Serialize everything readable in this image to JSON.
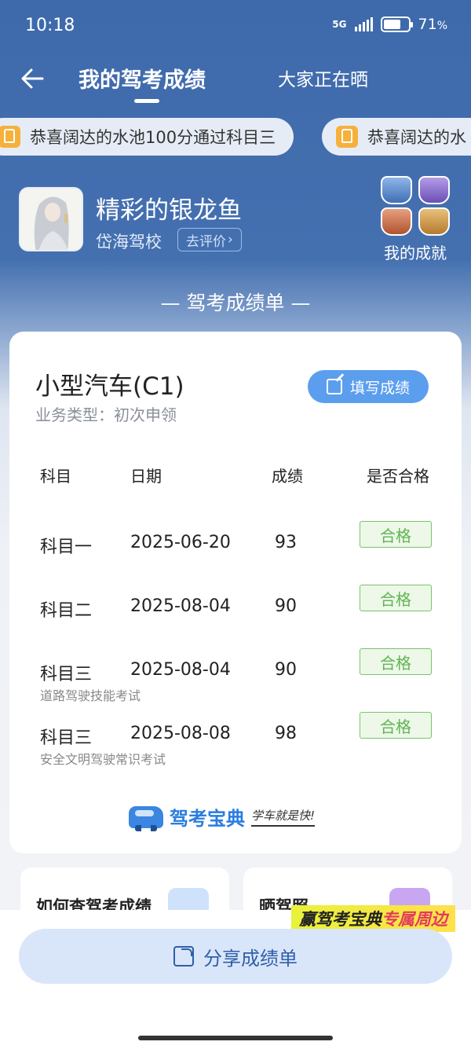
{
  "status": {
    "time": "10:18",
    "network": "5G",
    "battery": "71",
    "battery_level": 0.71
  },
  "nav": {
    "active_tab": "我的驾考成绩",
    "other_tab": "大家正在晒"
  },
  "ticker": [
    {
      "text": "恭喜阔达的水池100分通过科目三"
    },
    {
      "text": "恭喜阔达的水"
    }
  ],
  "profile": {
    "name": "精彩的银龙鱼",
    "school": "岱海驾校",
    "review": "去评价",
    "achievement": "我的成就"
  },
  "section_title": "— 驾考成绩单 —",
  "card": {
    "vehicle": "小型汽车(C1)",
    "business_type": "业务类型：初次申领",
    "fill_button": "填写成绩",
    "headers": {
      "subject": "科目",
      "date": "日期",
      "score": "成绩",
      "pass": "是否合格"
    },
    "rows": [
      {
        "subject": "科目一",
        "date": "2025-06-20",
        "score": "93",
        "status": "合格",
        "note": ""
      },
      {
        "subject": "科目二",
        "date": "2025-08-04",
        "score": "90",
        "status": "合格",
        "note": ""
      },
      {
        "subject": "科目三",
        "date": "2025-08-04",
        "score": "90",
        "status": "合格",
        "note": "道路驾驶技能考试"
      },
      {
        "subject": "科目三",
        "date": "2025-08-08",
        "score": "98",
        "status": "合格",
        "note": "安全文明驾驶常识考试"
      }
    ],
    "brand": "驾考宝典",
    "slogan": "学车就是快!"
  },
  "bottom": {
    "left_title": "如何查驾考成绩",
    "right_title": "晒驾照",
    "promo_a": "赢驾考宝典",
    "promo_b": "专属周边"
  },
  "share_button": "分享成绩单",
  "colors": {
    "header_bg": "#3e6aac",
    "accent": "#5b9eee",
    "pass_green": "#5fb552"
  }
}
